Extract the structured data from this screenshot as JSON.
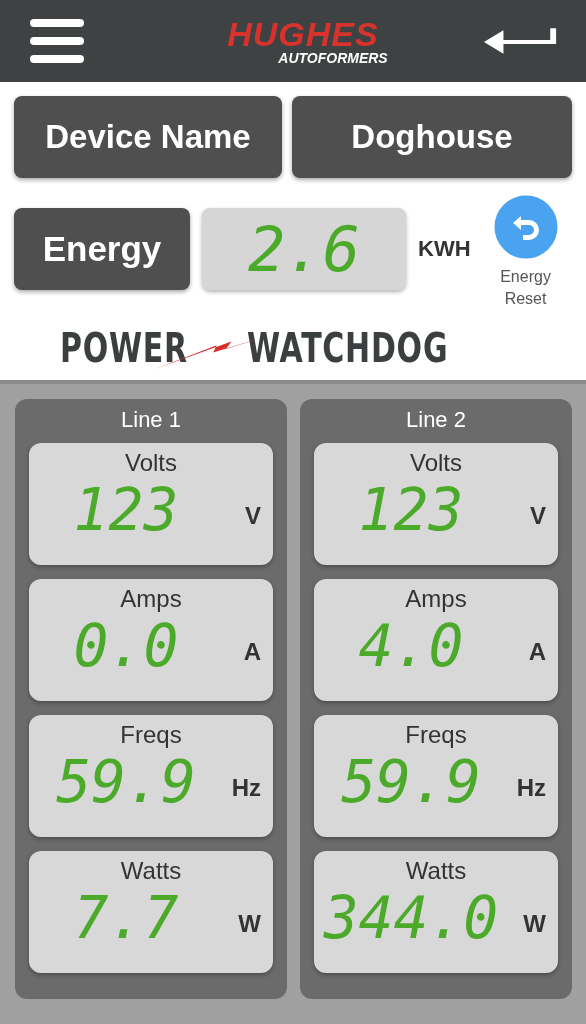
{
  "header": {
    "brand": {
      "name": "HUGHES",
      "subtitle": "AUTOFORMERS"
    }
  },
  "device": {
    "label": "Device Name",
    "value": "Doghouse"
  },
  "energy": {
    "label": "Energy",
    "value": "2.6",
    "unit": "KWH",
    "reset_label": "Energy Reset"
  },
  "product_logo": {
    "left": "POWER",
    "right": "WATCHDOG"
  },
  "lines": [
    {
      "title": "Line 1",
      "readings": [
        {
          "label": "Volts",
          "value": "123",
          "unit": "V"
        },
        {
          "label": "Amps",
          "value": "0.0",
          "unit": "A"
        },
        {
          "label": "Freqs",
          "value": "59.9",
          "unit": "Hz"
        },
        {
          "label": "Watts",
          "value": "7.7",
          "unit": "W"
        }
      ]
    },
    {
      "title": "Line 2",
      "readings": [
        {
          "label": "Volts",
          "value": "123",
          "unit": "V"
        },
        {
          "label": "Amps",
          "value": "4.0",
          "unit": "A"
        },
        {
          "label": "Freqs",
          "value": "59.9",
          "unit": "Hz"
        },
        {
          "label": "Watts",
          "value": "344.0",
          "unit": "W"
        }
      ]
    }
  ]
}
